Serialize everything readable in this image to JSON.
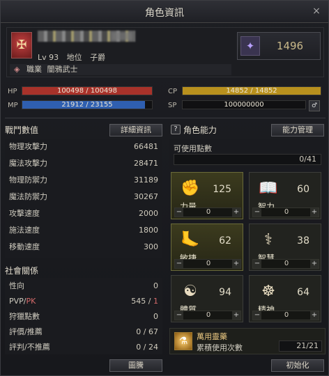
{
  "window": {
    "title": "角色資訊",
    "close_icon": "×"
  },
  "profile": {
    "crest_glyph": "✠",
    "level": "Lv 93",
    "status_label": "地位",
    "status_value": "子爵",
    "job_label": "職業",
    "job_value": "闇鴉武士",
    "combat_power": "1496",
    "cp_emblem_glyph": "✦"
  },
  "bars": {
    "hp": {
      "label": "HP",
      "text": "100498 / 100498",
      "fraction": 1.0,
      "color": "#a8322a"
    },
    "mp": {
      "label": "MP",
      "text": "21912 / 23155",
      "fraction": 0.946,
      "color": "#2f5fb0"
    },
    "cp": {
      "label": "CP",
      "text": "14852 / 14852",
      "fraction": 1.0,
      "color": "#b8901e"
    },
    "sp": {
      "label": "SP",
      "text": "100000000",
      "fraction": 0,
      "color": "#555"
    },
    "sp_button_glyph": "♂"
  },
  "combat": {
    "header": "戰鬥數值",
    "detail_button": "詳細資訊",
    "stats": [
      {
        "label": "物理攻擊力",
        "value": "66481"
      },
      {
        "label": "魔法攻擊力",
        "value": "28471"
      },
      {
        "label": "物理防禦力",
        "value": "31189"
      },
      {
        "label": "魔法防禦力",
        "value": "30267"
      },
      {
        "label": "攻擊速度",
        "value": "2000"
      },
      {
        "label": "施法速度",
        "value": "1800"
      },
      {
        "label": "移動速度",
        "value": "300"
      }
    ]
  },
  "social": {
    "header": "社會關係",
    "tendency_label": "性向",
    "tendency_value": "0",
    "pvp_label_a": "PVP/",
    "pvp_label_b": "PK",
    "pvp_value_a": "545",
    "pvp_sep": "/",
    "pvp_value_b": "1",
    "hunt_label": "狩獵點數",
    "hunt_value": "0",
    "rec_label": "評價/推薦",
    "rec_value": "0 / 67",
    "rej_label": "評判/不推薦",
    "rej_value": "0 / 24",
    "emblem_button": "圖騰"
  },
  "ability": {
    "header": "角色能力",
    "help_glyph": "?",
    "manage_button": "能力管理",
    "available_label": "可使用點數",
    "available_value": "0/41",
    "items": [
      {
        "name": "力量",
        "value": "125",
        "add": "0",
        "icon": "✊",
        "highlight": true
      },
      {
        "name": "智力",
        "value": "60",
        "add": "0",
        "icon": "📖",
        "highlight": false
      },
      {
        "name": "敏捷",
        "value": "62",
        "add": "0",
        "icon": "🦶",
        "highlight": true
      },
      {
        "name": "智慧",
        "value": "38",
        "add": "0",
        "icon": "⚕",
        "highlight": false
      },
      {
        "name": "體質",
        "value": "94",
        "add": "0",
        "icon": "☯",
        "highlight": false
      },
      {
        "name": "精神",
        "value": "64",
        "add": "0",
        "icon": "☸",
        "highlight": false
      }
    ],
    "minus": "−",
    "plus": "+",
    "elixir_name": "萬用靈藥",
    "elixir_sub": "累積使用次數",
    "elixir_value": "21/21",
    "reset_button": "初始化"
  }
}
